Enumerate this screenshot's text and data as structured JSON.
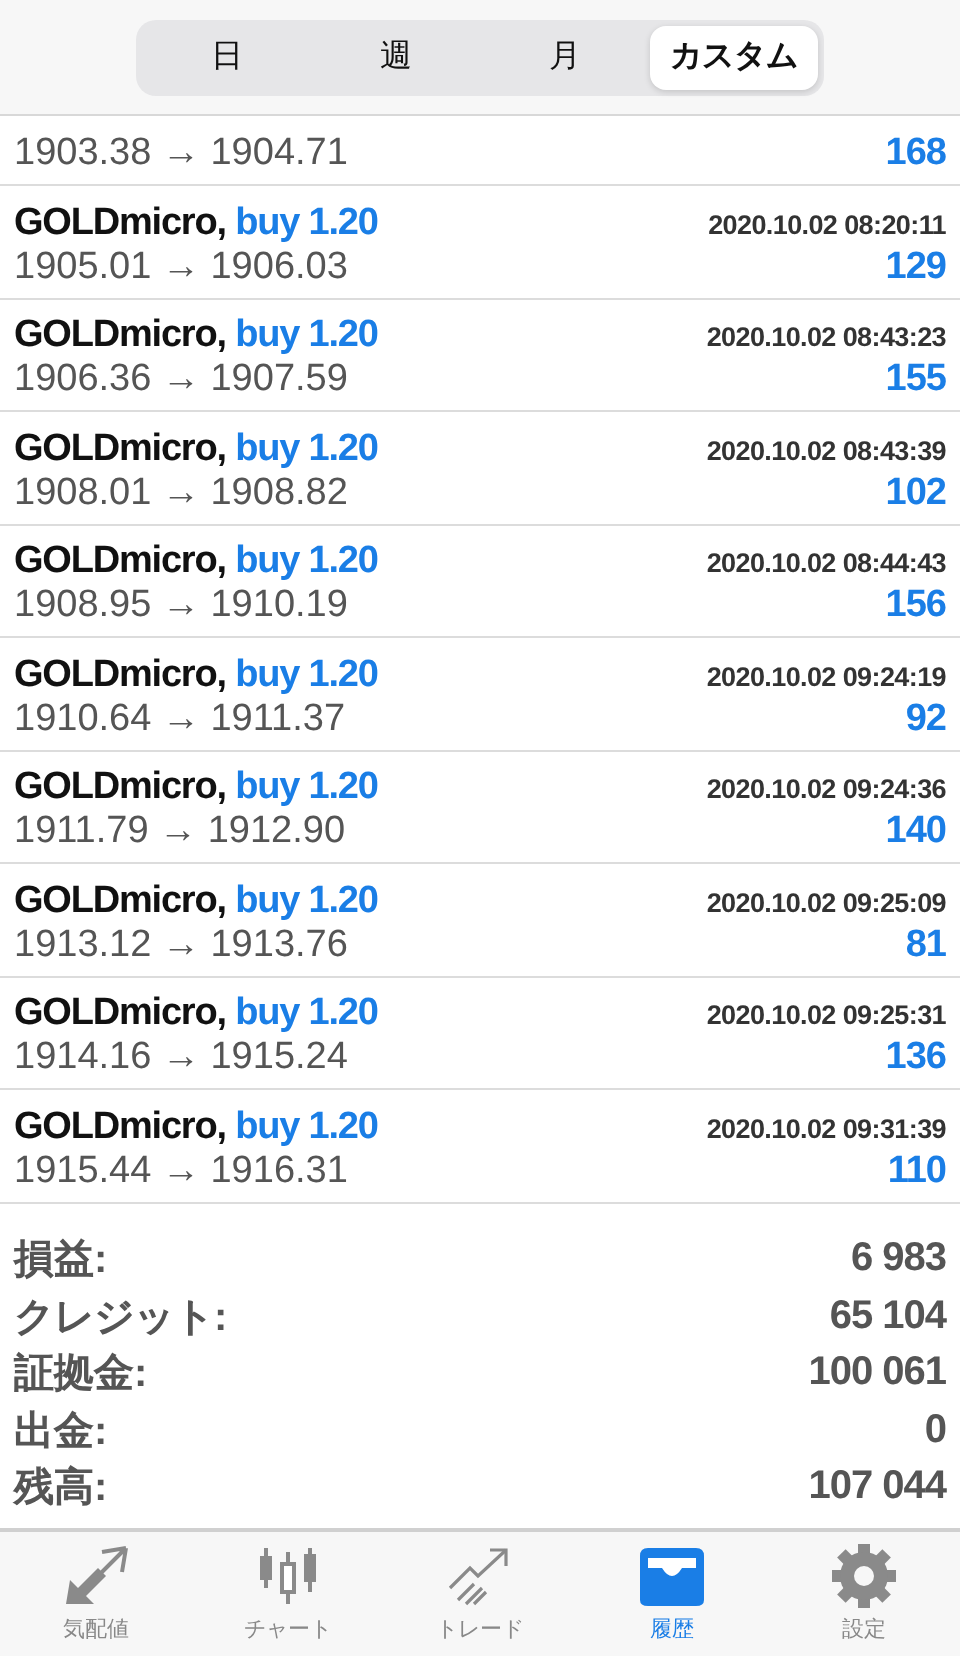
{
  "segments": [
    {
      "label": "日",
      "selected": false
    },
    {
      "label": "週",
      "selected": false
    },
    {
      "label": "月",
      "selected": false
    },
    {
      "label": "カスタム",
      "selected": true
    }
  ],
  "trades": [
    {
      "prices": "1903.38 → 1904.71",
      "profit": "168"
    },
    {
      "symbol": "GOLDmicro,",
      "order": "buy 1.20",
      "time": "2020.10.02 08:20:11",
      "prices": "1905.01 → 1906.03",
      "profit": "129"
    },
    {
      "symbol": "GOLDmicro,",
      "order": "buy 1.20",
      "time": "2020.10.02 08:43:23",
      "prices": "1906.36 → 1907.59",
      "profit": "155"
    },
    {
      "symbol": "GOLDmicro,",
      "order": "buy 1.20",
      "time": "2020.10.02 08:43:39",
      "prices": "1908.01 → 1908.82",
      "profit": "102"
    },
    {
      "symbol": "GOLDmicro,",
      "order": "buy 1.20",
      "time": "2020.10.02 08:44:43",
      "prices": "1908.95 → 1910.19",
      "profit": "156"
    },
    {
      "symbol": "GOLDmicro,",
      "order": "buy 1.20",
      "time": "2020.10.02 09:24:19",
      "prices": "1910.64 → 1911.37",
      "profit": "92"
    },
    {
      "symbol": "GOLDmicro,",
      "order": "buy 1.20",
      "time": "2020.10.02 09:24:36",
      "prices": "1911.79 → 1912.90",
      "profit": "140"
    },
    {
      "symbol": "GOLDmicro,",
      "order": "buy 1.20",
      "time": "2020.10.02 09:25:09",
      "prices": "1913.12 → 1913.76",
      "profit": "81"
    },
    {
      "symbol": "GOLDmicro,",
      "order": "buy 1.20",
      "time": "2020.10.02 09:25:31",
      "prices": "1914.16 → 1915.24",
      "profit": "136"
    },
    {
      "symbol": "GOLDmicro,",
      "order": "buy 1.20",
      "time": "2020.10.02 09:31:39",
      "prices": "1915.44 → 1916.31",
      "profit": "110"
    }
  ],
  "summary": [
    {
      "label": "損益:",
      "value": "6 983"
    },
    {
      "label": "クレジット:",
      "value": "65 104"
    },
    {
      "label": "証拠金:",
      "value": "100 061"
    },
    {
      "label": "出金:",
      "value": "0"
    },
    {
      "label": "残高:",
      "value": "107 044"
    }
  ],
  "tab_bar": [
    {
      "kind": "quotes",
      "label": "気配値",
      "selected": false
    },
    {
      "kind": "chart",
      "label": "チャート",
      "selected": false
    },
    {
      "kind": "trade",
      "label": "トレード",
      "selected": false
    },
    {
      "kind": "history",
      "label": "履歴",
      "selected": true
    },
    {
      "kind": "settings",
      "label": "設定",
      "selected": false
    }
  ]
}
